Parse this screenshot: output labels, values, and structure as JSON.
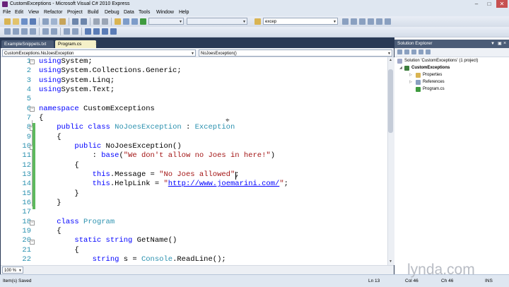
{
  "window": {
    "title": "CustomExceptions - Microsoft Visual C# 2010 Express"
  },
  "menu": [
    "File",
    "Edit",
    "View",
    "Refactor",
    "Project",
    "Build",
    "Debug",
    "Data",
    "Tools",
    "Window",
    "Help"
  ],
  "toolbar": {
    "find_value": "excep"
  },
  "tabs": [
    {
      "label": "ExampleSnippets.txt",
      "active": false
    },
    {
      "label": "Program.cs",
      "active": true
    }
  ],
  "navbar": {
    "type_combo": "CustomExceptions.NoJoesException",
    "member_combo": "NoJoesException()"
  },
  "code_lines": [
    {
      "n": "1",
      "segs": [
        [
          "kw",
          "using"
        ],
        [
          "",
          "System;"
        ]
      ]
    },
    {
      "n": "2",
      "segs": [
        [
          "kw",
          "using"
        ],
        [
          "",
          "System.Collections.Generic;"
        ]
      ]
    },
    {
      "n": "3",
      "segs": [
        [
          "kw",
          "using"
        ],
        [
          "",
          "System.Linq;"
        ]
      ]
    },
    {
      "n": "4",
      "segs": [
        [
          "kw",
          "using"
        ],
        [
          "",
          "System.Text;"
        ]
      ]
    },
    {
      "n": "5",
      "segs": []
    },
    {
      "n": "6",
      "segs": [
        [
          "kw",
          "namespace"
        ],
        [
          "",
          " CustomExceptions"
        ]
      ]
    },
    {
      "n": "7",
      "segs": [
        [
          "",
          "{"
        ]
      ]
    },
    {
      "n": "8",
      "segs": [
        [
          "",
          "    "
        ],
        [
          "kw",
          "public class"
        ],
        [
          "",
          " "
        ],
        [
          "ty",
          "NoJoesException"
        ],
        [
          "",
          " : "
        ],
        [
          "ty",
          "Exception"
        ]
      ]
    },
    {
      "n": "9",
      "segs": [
        [
          "",
          "    {"
        ]
      ]
    },
    {
      "n": "10",
      "segs": [
        [
          "",
          "        "
        ],
        [
          "kw",
          "public"
        ],
        [
          "",
          " NoJoesException()"
        ]
      ]
    },
    {
      "n": "11",
      "segs": [
        [
          "",
          "            : "
        ],
        [
          "kw",
          "base"
        ],
        [
          "",
          "("
        ],
        [
          "st",
          "\"We don't allow no Joes in here!\""
        ],
        [
          "",
          ")"
        ]
      ]
    },
    {
      "n": "12",
      "segs": [
        [
          "",
          "        {"
        ]
      ]
    },
    {
      "n": "13",
      "segs": [
        [
          "",
          "            "
        ],
        [
          "kw",
          "this"
        ],
        [
          "",
          ".Message = "
        ],
        [
          "st",
          "\"No Joes allowed\""
        ],
        [
          "",
          ";"
        ]
      ]
    },
    {
      "n": "14",
      "segs": [
        [
          "",
          "            "
        ],
        [
          "kw",
          "this"
        ],
        [
          "",
          ".HelpLink = "
        ],
        [
          "st",
          "\""
        ],
        [
          "lk",
          "http://www.joemarini.com/"
        ],
        [
          "st",
          "\""
        ],
        [
          "",
          ";"
        ]
      ]
    },
    {
      "n": "15",
      "segs": [
        [
          "",
          "        }"
        ]
      ]
    },
    {
      "n": "16",
      "segs": [
        [
          "",
          "    }"
        ]
      ]
    },
    {
      "n": "17",
      "segs": []
    },
    {
      "n": "18",
      "segs": [
        [
          "",
          "    "
        ],
        [
          "kw",
          "class"
        ],
        [
          "",
          " "
        ],
        [
          "ty",
          "Program"
        ]
      ]
    },
    {
      "n": "19",
      "segs": [
        [
          "",
          "    {"
        ]
      ]
    },
    {
      "n": "20",
      "segs": [
        [
          "",
          "        "
        ],
        [
          "kw",
          "static string"
        ],
        [
          "",
          " GetName()"
        ]
      ]
    },
    {
      "n": "21",
      "segs": [
        [
          "",
          "        {"
        ]
      ]
    },
    {
      "n": "22",
      "segs": [
        [
          "",
          "            "
        ],
        [
          "kw",
          "string"
        ],
        [
          "",
          " s = "
        ],
        [
          "ty",
          "Console"
        ],
        [
          "",
          ".ReadLine();"
        ]
      ]
    }
  ],
  "zoom": "100 %",
  "solution_explorer": {
    "title": "Solution Explorer",
    "solution": "Solution 'CustomExceptions' (1 project)",
    "project": "CustomExceptions",
    "items": [
      "Properties",
      "References",
      "Program.cs"
    ]
  },
  "status": {
    "message": "Item(s) Saved",
    "line": "Ln 13",
    "col": "Col 46",
    "ch": "Ch 46",
    "mode": "INS"
  },
  "watermark": "lynda.com"
}
